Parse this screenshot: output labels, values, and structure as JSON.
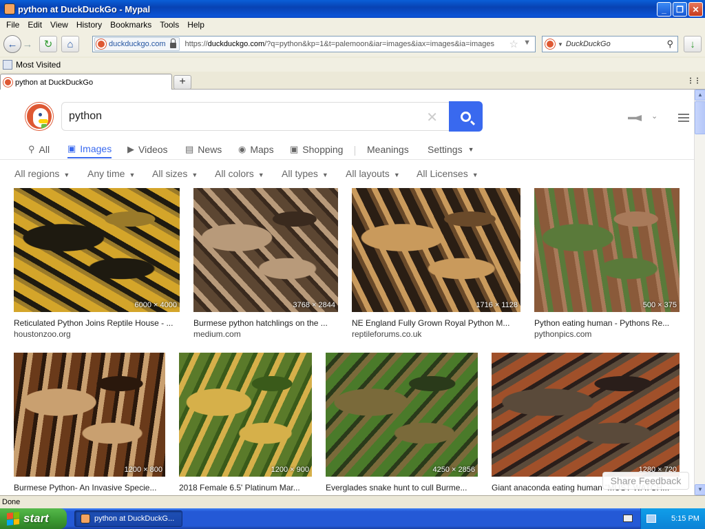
{
  "window": {
    "title": "python at DuckDuckGo - Mypal",
    "controls": {
      "minimize": "_",
      "maximize": "❐",
      "close": "✕"
    }
  },
  "menu": [
    "File",
    "Edit",
    "View",
    "History",
    "Bookmarks",
    "Tools",
    "Help"
  ],
  "nav": {
    "identity": "duckduckgo.com",
    "url_prefix": "https://",
    "url_host": "duckduckgo.com",
    "url_rest": "/?q=python&kp=1&t=palemoon&iar=images&iax=images&ia=images",
    "search_placeholder": "DuckDuckGo"
  },
  "bookmarks": {
    "most_visited": "Most Visited"
  },
  "tab": {
    "title": "python at DuckDuckGo"
  },
  "ddg": {
    "query": "python",
    "tabs": [
      {
        "label": "All",
        "icon": "search-icon"
      },
      {
        "label": "Images",
        "icon": "image-icon",
        "active": true
      },
      {
        "label": "Videos",
        "icon": "video-icon"
      },
      {
        "label": "News",
        "icon": "news-icon"
      },
      {
        "label": "Maps",
        "icon": "map-pin-icon"
      },
      {
        "label": "Shopping",
        "icon": "shopping-bag-icon"
      },
      {
        "label": "Meanings"
      },
      {
        "label": "Settings"
      }
    ],
    "filters": [
      "All regions",
      "Any time",
      "All sizes",
      "All colors",
      "All types",
      "All layouts",
      "All Licenses"
    ],
    "results": [
      {
        "caption": "Reticulated Python Joins Reptile House - ...",
        "source": "houstonzoo.org",
        "dims": "6000 × 4000",
        "colors": [
          "#d4a52a",
          "#1e1a10",
          "#9a7a2a"
        ]
      },
      {
        "caption": "Burmese python hatchlings on the ...",
        "source": "medium.com",
        "dims": "3768 × 2844",
        "colors": [
          "#5c4632",
          "#b89a7a",
          "#3a2a1e"
        ]
      },
      {
        "caption": "NE England Fully Grown Royal Python M...",
        "source": "reptileforums.co.uk",
        "dims": "1716 × 1128",
        "colors": [
          "#2a1e14",
          "#c99a5c",
          "#6a4a2a"
        ]
      },
      {
        "caption": "Python eating human - Pythons Re...",
        "source": "pythonpics.com",
        "dims": "500 × 375",
        "colors": [
          "#8a5a3a",
          "#5a7a3a",
          "#a87a5a"
        ]
      },
      {
        "caption": "Burmese Python- An Invasive Specie...",
        "source": "",
        "dims": "1200 × 800",
        "colors": [
          "#6a3a1a",
          "#c9a070",
          "#2a180c"
        ]
      },
      {
        "caption": "2018 Female 6.5' Platinum Mar...",
        "source": "",
        "dims": "1200 × 900",
        "colors": [
          "#5a7a2a",
          "#d6b04a",
          "#3a5a1a"
        ]
      },
      {
        "caption": "Everglades snake hunt to cull Burme...",
        "source": "",
        "dims": "4250 × 2856",
        "colors": [
          "#4a7a2a",
          "#7a6a3a",
          "#2a3a1a"
        ]
      },
      {
        "caption": "Giant anaconda eating human \"MUST WATCH...",
        "source": "",
        "dims": "1280 × 720",
        "colors": [
          "#a0502a",
          "#5a4a3a",
          "#2a1e1a"
        ]
      }
    ],
    "share_feedback": "Share Feedback"
  },
  "status": {
    "text": "Done"
  },
  "taskbar": {
    "start": "start",
    "task": "python at DuckDuckG...",
    "time": "5:15 PM"
  }
}
